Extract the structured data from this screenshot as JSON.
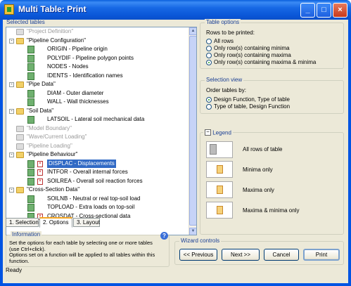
{
  "window": {
    "title": "Multi Table: Print"
  },
  "selected_tables": {
    "title": "Selected tables",
    "rows": [
      {
        "level": 0,
        "type": "folder",
        "grey": true,
        "toggle": "",
        "label": "\"Project Definition\""
      },
      {
        "level": 0,
        "type": "folder",
        "grey": false,
        "toggle": "-",
        "label": "\"Pipeline Configuration\""
      },
      {
        "level": 1,
        "type": "table",
        "label": "ORIGIN - Pipeline origin"
      },
      {
        "level": 1,
        "type": "table",
        "label": "POLYDIF - Pipeline polygon points"
      },
      {
        "level": 1,
        "type": "table",
        "label": "NODES - Nodes"
      },
      {
        "level": 1,
        "type": "table",
        "label": "IDENTS - Identification names"
      },
      {
        "level": 0,
        "type": "folder",
        "grey": false,
        "toggle": "-",
        "label": "\"Pipe Data\""
      },
      {
        "level": 1,
        "type": "table",
        "label": "DIAM - Outer diameter"
      },
      {
        "level": 1,
        "type": "table",
        "label": "WALL - Wall thicknesses"
      },
      {
        "level": 0,
        "type": "folder",
        "grey": false,
        "toggle": "-",
        "label": "\"Soil Data\""
      },
      {
        "level": 1,
        "type": "table",
        "label": "LATSOIL - Lateral soil mechanical data"
      },
      {
        "level": 0,
        "type": "folder",
        "grey": true,
        "toggle": "",
        "label": "\"Model Boundary\""
      },
      {
        "level": 0,
        "type": "folder",
        "grey": true,
        "toggle": "",
        "label": "\"Wave/Current Loading\""
      },
      {
        "level": 0,
        "type": "folder",
        "grey": true,
        "toggle": "",
        "label": "\"Pipeline Loading\""
      },
      {
        "level": 0,
        "type": "folder",
        "grey": false,
        "toggle": "-",
        "label": "\"Pipeline Behaviour\""
      },
      {
        "level": 1,
        "type": "table",
        "err": true,
        "selected": true,
        "label": "DISPLAC - Displacements"
      },
      {
        "level": 1,
        "type": "table",
        "err": true,
        "label": "INTFOR - Overall internal forces"
      },
      {
        "level": 1,
        "type": "table",
        "err": true,
        "label": "SOILREA - Overall soil reaction forces"
      },
      {
        "level": 0,
        "type": "folder",
        "grey": false,
        "toggle": "-",
        "label": "\"Cross-Section Data\""
      },
      {
        "level": 1,
        "type": "table",
        "label": "SOILNB - Neutral or real top-soil load"
      },
      {
        "level": 1,
        "type": "table",
        "label": "TOPLOAD - Extra loads on top-soil"
      },
      {
        "level": 1,
        "type": "table",
        "err": true,
        "label": "CROSDAT - Cross-sectional data"
      }
    ]
  },
  "tabs": [
    {
      "label": "1. Selection",
      "active": false
    },
    {
      "label": "2. Options",
      "active": true
    },
    {
      "label": "3. Layout",
      "active": false
    }
  ],
  "table_options": {
    "title": "Table options",
    "rows_label": "Rows to be printed:",
    "options": [
      {
        "label": "All rows",
        "checked": false
      },
      {
        "label": "Only row(s) containing minima",
        "checked": false
      },
      {
        "label": "Only row(s) containing maxima",
        "checked": false
      },
      {
        "label": "Only row(s) containing maxima & minima",
        "checked": true
      }
    ]
  },
  "selection_view": {
    "title": "Selection view",
    "order_label": "Order tables by:",
    "options": [
      {
        "label": "Design Function, Type of table",
        "checked": true
      },
      {
        "label": "Type of table, Design Function",
        "checked": false
      }
    ]
  },
  "legend": {
    "title": "Legend",
    "items": [
      {
        "label": "All rows of table"
      },
      {
        "label": "Minima only"
      },
      {
        "label": "Maxima only"
      },
      {
        "label": "Maxima & minima only"
      }
    ]
  },
  "information": {
    "title": "Information",
    "text_lines": [
      "Set the options for each table by selecting one or more tables",
      "(use Ctrl+click).",
      "Options set on a function will be applied to all tables within this",
      "function."
    ]
  },
  "wizard": {
    "title": "Wizard controls",
    "previous": "<< Previous",
    "next": "Next >>",
    "cancel": "Cancel",
    "print": "Print"
  },
  "status": {
    "text": "Ready"
  }
}
